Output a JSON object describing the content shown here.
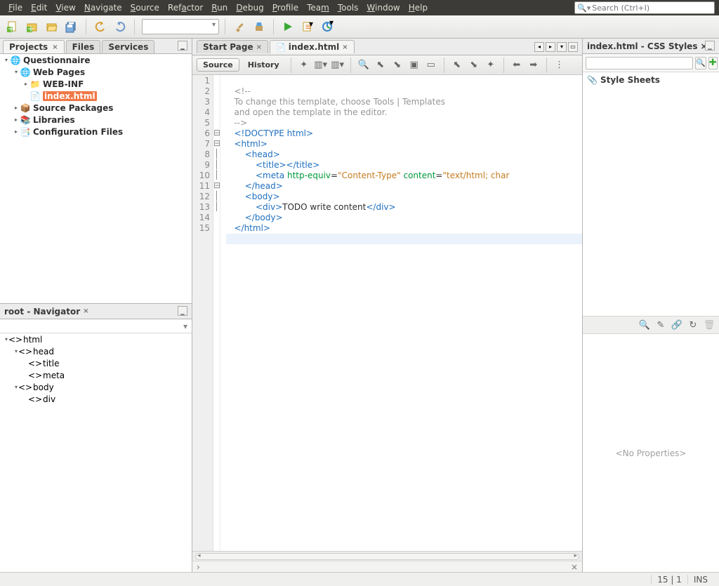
{
  "menu": [
    "File",
    "Edit",
    "View",
    "Navigate",
    "Source",
    "Refactor",
    "Run",
    "Debug",
    "Profile",
    "Team",
    "Tools",
    "Window",
    "Help"
  ],
  "search_placeholder": "Search (Ctrl+I)",
  "projects": {
    "tabs": [
      "Projects",
      "Files",
      "Services"
    ],
    "tree": {
      "root": "Questionnaire",
      "webpages": "Web Pages",
      "webinf": "WEB-INF",
      "index": "index.html",
      "srcpkg": "Source Packages",
      "libs": "Libraries",
      "config": "Configuration Files"
    }
  },
  "navigator": {
    "title": "root - Navigator",
    "items": {
      "html": "html",
      "head": "head",
      "title": "title",
      "meta": "meta",
      "body": "body",
      "div": "div"
    }
  },
  "editor": {
    "tabs": [
      {
        "label": "Start Page"
      },
      {
        "label": "index.html"
      }
    ],
    "sub": {
      "source": "Source",
      "history": "History"
    },
    "code": {
      "l1": "<!--",
      "l2": "To change this template, choose Tools | Templates",
      "l3": "and open the template in the editor.",
      "l4": "-->",
      "l5": "<!DOCTYPE html>",
      "l6o": "<",
      "l6t": "html",
      "l6c": ">",
      "l7o": "<",
      "l7t": "head",
      "l7c": ">",
      "l8o": "<",
      "l8t": "title",
      "l8c": "></",
      "l8t2": "title",
      "l8e": ">",
      "l9o": "<",
      "l9t": "meta",
      "l9sp": " ",
      "l9a1": "http-equiv",
      "l9eq": "=",
      "l9v1": "\"Content-Type\"",
      "l9sp2": " ",
      "l9a2": "content",
      "l9eq2": "=",
      "l9v2": "\"text/html; char",
      "l10o": "</",
      "l10t": "head",
      "l10c": ">",
      "l11o": "<",
      "l11t": "body",
      "l11c": ">",
      "l12o": "<",
      "l12t": "div",
      "l12c": ">",
      "l12txt": "TODO write content",
      "l12co": "</",
      "l12t2": "div",
      "l12e": ">",
      "l13o": "</",
      "l13t": "body",
      "l13c": ">",
      "l14o": "</",
      "l14t": "html",
      "l14c": ">"
    },
    "linenums": [
      "1",
      "2",
      "3",
      "4",
      "5",
      "6",
      "7",
      "8",
      "9",
      "10",
      "11",
      "12",
      "13",
      "14",
      "15"
    ]
  },
  "css": {
    "title": "index.html - CSS Styles",
    "sheets": "Style Sheets",
    "noprops": "<No Properties>"
  },
  "status": {
    "pos": "15 | 1",
    "mode": "INS"
  }
}
